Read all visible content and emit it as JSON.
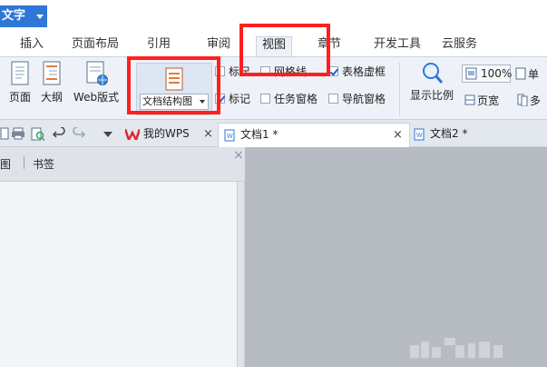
{
  "app": {
    "menu_label": "文字"
  },
  "menu": {
    "tabs": [
      {
        "label": "插入"
      },
      {
        "label": "页面布局"
      },
      {
        "label": "引用"
      },
      {
        "label": "审阅"
      },
      {
        "label": "视图"
      },
      {
        "label": "章节"
      },
      {
        "label": "开发工具"
      },
      {
        "label": "云服务"
      }
    ]
  },
  "ribbon": {
    "view_buttons": [
      {
        "label": "页面"
      },
      {
        "label": "大纲"
      },
      {
        "label": "Web版式"
      }
    ],
    "docmap_label": "文档结构图",
    "checkboxes": {
      "ruler": {
        "label": "标尺",
        "checked": false
      },
      "gridlines": {
        "label": "网格线",
        "checked": false
      },
      "table_gridlines": {
        "label": "表格虚框",
        "checked": true
      },
      "marks": {
        "label": "标记",
        "checked": true
      },
      "task_pane": {
        "label": "任务窗格",
        "checked": false
      },
      "nav_pane": {
        "label": "导航窗格",
        "checked": false
      }
    },
    "zoom_label": "显示比例",
    "zoom_value": "100%",
    "page_width_label": "页宽",
    "single_page_partial": "单",
    "multi_page_partial": "多"
  },
  "doc_tabs": [
    {
      "label": "我的WPS",
      "close": "×"
    },
    {
      "label": "文档1 *",
      "close": "×"
    },
    {
      "label": "文档2 *"
    }
  ],
  "nav_panel": {
    "tabs": [
      {
        "label": "图"
      },
      {
        "label": "书签"
      }
    ],
    "close": "×"
  },
  "colors": {
    "accent": "#2f76d6",
    "highlight": "#ff1f1f",
    "wps_red": "#e0262c"
  }
}
